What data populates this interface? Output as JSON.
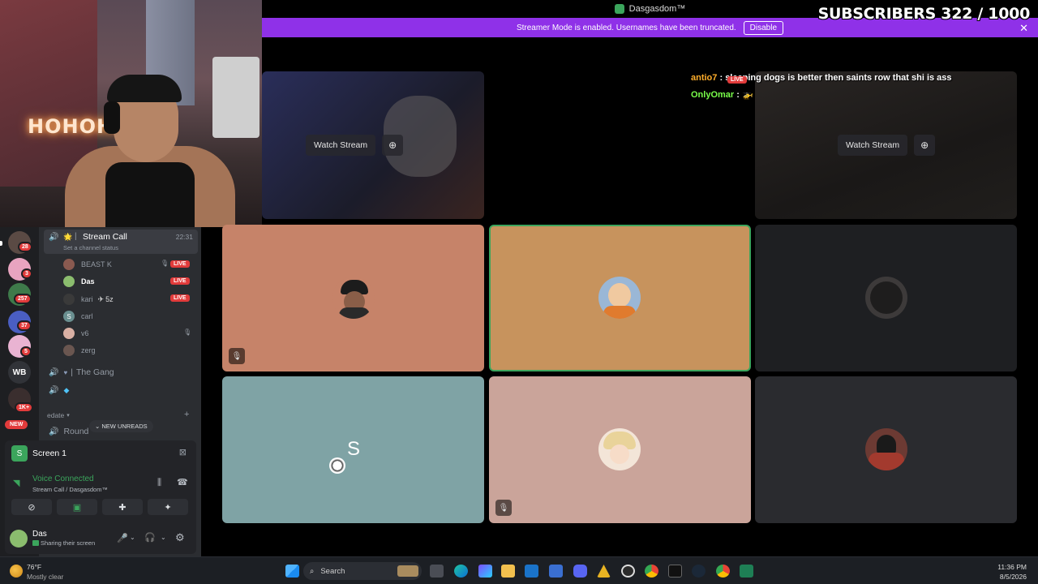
{
  "window": {
    "title": "Dasgasdom™"
  },
  "overlay": {
    "subscribers": "SUBSCRIBERS 322 / 1000"
  },
  "banner": {
    "message": "Streamer Mode is enabled. Usernames have been truncated.",
    "disable_label": "Disable",
    "color": "#8f31e8"
  },
  "webcam": {
    "neon_text": "HOHOHO"
  },
  "streams": {
    "watch_label": "Watch Stream",
    "chat": [
      {
        "user": "antio7",
        "text": ": sleeping dogs is better then saints row that shi is ass"
      },
      {
        "user": "OnlyOmar",
        "text": ": 🚁"
      }
    ],
    "live_tag": "LIVE",
    "tiles": [
      {
        "bg": "#c68369"
      },
      {
        "bg": "#c7935d",
        "speaking": true
      },
      {
        "bg": "#1e1f22"
      },
      {
        "bg": "#7fa3a5",
        "letter": "S"
      },
      {
        "bg": "#caa49a"
      },
      {
        "bg": "#2a2b2f"
      }
    ]
  },
  "rail": {
    "servers": [
      {
        "badge": "28",
        "color": "#5a4a44"
      },
      {
        "badge": "3",
        "color": "#e8a4c0"
      },
      {
        "badge": "257",
        "color": "#3e7a4a"
      },
      {
        "badge": "37",
        "color": "#4a5ec2"
      },
      {
        "badge": "5",
        "color": "#e9b3d2"
      },
      {
        "label": "WB",
        "color": "#313338"
      },
      {
        "badge": "1K+",
        "color": "#2f2a2a"
      }
    ],
    "new_label": "NEW"
  },
  "sidebar": {
    "stream_call": {
      "emoji": "🌟",
      "name": "Stream Call",
      "time": "22:31",
      "status_placeholder": "Set a channel status"
    },
    "users": [
      {
        "name": "BEAST K",
        "live": true,
        "muted": true,
        "color": "#8a5a50"
      },
      {
        "name": "Das",
        "live": true,
        "bold": true,
        "color": "#8bbd6e"
      },
      {
        "name": "kari",
        "extra": "5z",
        "live": true,
        "color": "#3a3a3a"
      },
      {
        "name": "carl",
        "letter": "S",
        "color": "#6a8f90"
      },
      {
        "name": "v6",
        "muted": true,
        "color": "#d9b0a4"
      },
      {
        "name": "zerg",
        "color": "#6a5650"
      }
    ],
    "the_gang": "The Gang",
    "category": "edate",
    "round_channel": "Round",
    "new_unreads": "NEW UNREADS"
  },
  "panel": {
    "screen_label": "Screen 1",
    "voice_connected": "Voice Connected",
    "voice_channel": "Stream Call / Dasgasdom™",
    "user_name": "Das",
    "user_status": "Sharing their screen"
  },
  "taskbar": {
    "weather_temp": "76°F",
    "weather_desc": "Mostly clear",
    "search_placeholder": "Search",
    "time": "11:36 PM",
    "date": "8/5/2026"
  }
}
